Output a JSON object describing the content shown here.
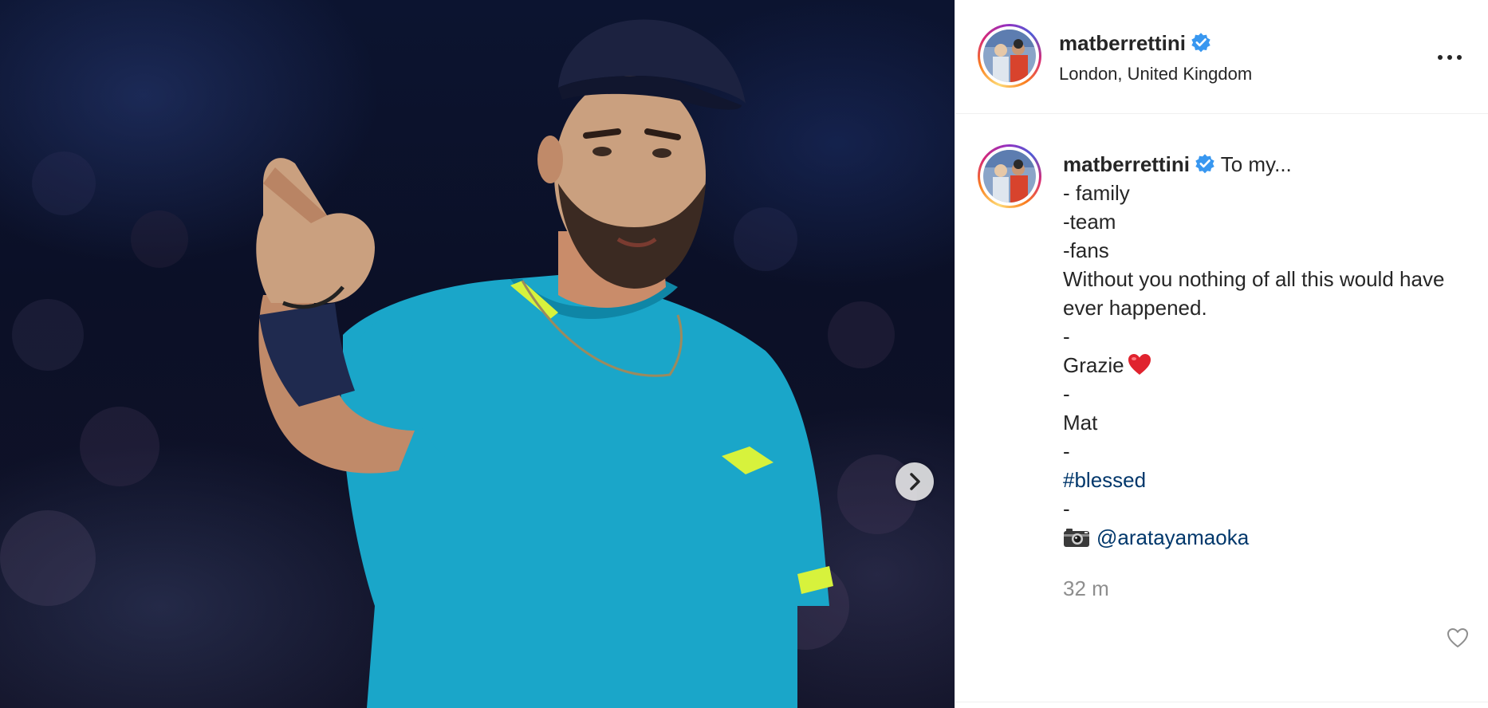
{
  "post": {
    "username": "matberrettini",
    "location": "London, United Kingdom",
    "verified": true,
    "caption_lines": [
      "- family",
      "-team",
      "-fans",
      "Without you nothing of all this would have ever happened.",
      "-"
    ],
    "caption_first": "To my...",
    "grazie": "Grazie",
    "sep2": "-",
    "signature": "Mat",
    "sep3": "-",
    "hashtag": "#blessed",
    "sep4": "-",
    "mention": "@aratayamaoka",
    "timestamp": "32 m"
  },
  "icons": {
    "verified": "verified-badge-icon",
    "more": "more-options-icon",
    "next": "chevron-right-icon",
    "like": "heart-outline-icon",
    "heart_emoji": "red-heart-emoji",
    "camera_emoji": "camera-emoji"
  },
  "colors": {
    "link": "#00376b",
    "verified": "#3897f0",
    "shirt": "#1aa6c9",
    "muted": "#8e8e8e"
  }
}
